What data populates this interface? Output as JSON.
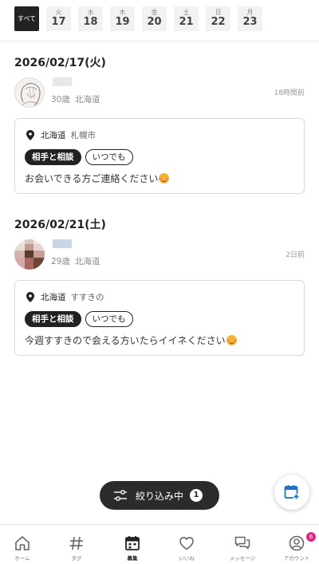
{
  "date_bar": {
    "all_label": "すべて",
    "days": [
      {
        "dow": "火",
        "day": "17"
      },
      {
        "dow": "水",
        "day": "18"
      },
      {
        "dow": "木",
        "day": "19"
      },
      {
        "dow": "金",
        "day": "20"
      },
      {
        "dow": "土",
        "day": "21"
      },
      {
        "dow": "日",
        "day": "22"
      },
      {
        "dow": "月",
        "day": "23"
      }
    ]
  },
  "posts": [
    {
      "date_heading": "2026/02/17(火)",
      "age": "30歳",
      "prefecture": "北海道",
      "time_ago": "18時間前",
      "card_prefecture": "北海道",
      "card_area": "札幌市",
      "tags": [
        "相手と相談",
        "いつでも"
      ],
      "message": "お会いできる方ご連絡ください"
    },
    {
      "date_heading": "2026/02/21(土)",
      "age": "29歳",
      "prefecture": "北海道",
      "time_ago": "2日前",
      "card_prefecture": "北海道",
      "card_area": "すすきの",
      "tags": [
        "相手と相談",
        "いつでも"
      ],
      "message": "今週すすきので会える方いたらイイネください"
    }
  ],
  "filter": {
    "label": "絞り込み中",
    "count": "1"
  },
  "bottom_nav": {
    "items": [
      {
        "label": "ホーム",
        "icon": "home-icon"
      },
      {
        "label": "タグ",
        "icon": "hashtag-icon"
      },
      {
        "label": "募集",
        "icon": "calendar-icon"
      },
      {
        "label": "いいね",
        "icon": "heart-icon"
      },
      {
        "label": "メッセージ",
        "icon": "chat-icon"
      },
      {
        "label": "アカウント",
        "icon": "user-icon"
      }
    ],
    "active": "募集",
    "account_badge": "6"
  },
  "colors": {
    "accent_blue": "#1a73c9",
    "badge_pink": "#e0268a",
    "dark": "#222222"
  }
}
